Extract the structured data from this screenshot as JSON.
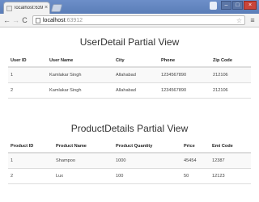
{
  "browser": {
    "tab_title": "localhost:63912",
    "tab_close": "×",
    "url_host": "localhost",
    "url_port": ":63912",
    "back_glyph": "←",
    "forward_glyph": "→",
    "reload_glyph": "C",
    "star_glyph": "☆",
    "menu_glyph": "≡",
    "minimize_glyph": "–",
    "maximize_glyph": "□",
    "close_glyph": "×"
  },
  "user_section": {
    "title": "UserDetail Partial View",
    "columns": [
      "User ID",
      "User Name",
      "City",
      "Phone",
      "Zip Code"
    ],
    "rows": [
      [
        "1",
        "Kamlakar Singh",
        "Allahabad",
        "1234567890",
        "212106"
      ],
      [
        "2",
        "Kamlakar Singh",
        "Allahabad",
        "1234567890",
        "212106"
      ]
    ]
  },
  "product_section": {
    "title": "ProductDetails Partial View",
    "columns": [
      "Product ID",
      "Product Name",
      "Product Quantity",
      "Price",
      "Emi Code"
    ],
    "rows": [
      [
        "1",
        "Shampoo",
        "1000",
        "45454",
        "12387"
      ],
      [
        "2",
        "Lux",
        "100",
        "50",
        "12123"
      ]
    ]
  },
  "colors": {
    "titlebar": "#5a7db8",
    "row_stripe": "#f9f9f9",
    "border": "#dddddd"
  }
}
